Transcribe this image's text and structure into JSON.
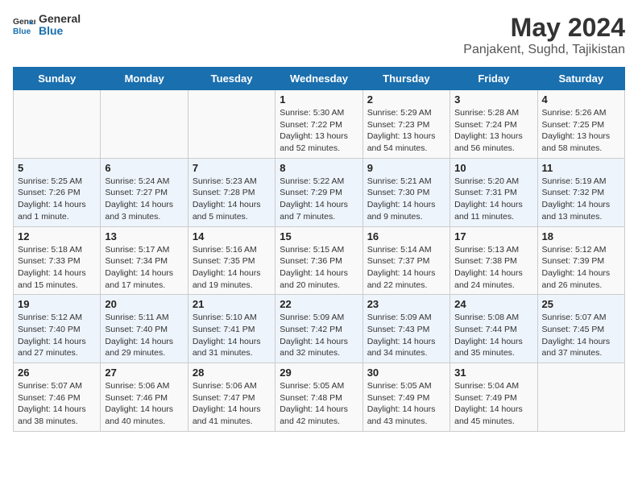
{
  "logo": {
    "line1": "General",
    "line2": "Blue"
  },
  "title": "May 2024",
  "subtitle": "Panjakent, Sughd, Tajikistan",
  "weekdays": [
    "Sunday",
    "Monday",
    "Tuesday",
    "Wednesday",
    "Thursday",
    "Friday",
    "Saturday"
  ],
  "weeks": [
    [
      {
        "day": "",
        "sunrise": "",
        "sunset": "",
        "daylight": ""
      },
      {
        "day": "",
        "sunrise": "",
        "sunset": "",
        "daylight": ""
      },
      {
        "day": "",
        "sunrise": "",
        "sunset": "",
        "daylight": ""
      },
      {
        "day": "1",
        "sunrise": "Sunrise: 5:30 AM",
        "sunset": "Sunset: 7:22 PM",
        "daylight": "Daylight: 13 hours and 52 minutes."
      },
      {
        "day": "2",
        "sunrise": "Sunrise: 5:29 AM",
        "sunset": "Sunset: 7:23 PM",
        "daylight": "Daylight: 13 hours and 54 minutes."
      },
      {
        "day": "3",
        "sunrise": "Sunrise: 5:28 AM",
        "sunset": "Sunset: 7:24 PM",
        "daylight": "Daylight: 13 hours and 56 minutes."
      },
      {
        "day": "4",
        "sunrise": "Sunrise: 5:26 AM",
        "sunset": "Sunset: 7:25 PM",
        "daylight": "Daylight: 13 hours and 58 minutes."
      }
    ],
    [
      {
        "day": "5",
        "sunrise": "Sunrise: 5:25 AM",
        "sunset": "Sunset: 7:26 PM",
        "daylight": "Daylight: 14 hours and 1 minute."
      },
      {
        "day": "6",
        "sunrise": "Sunrise: 5:24 AM",
        "sunset": "Sunset: 7:27 PM",
        "daylight": "Daylight: 14 hours and 3 minutes."
      },
      {
        "day": "7",
        "sunrise": "Sunrise: 5:23 AM",
        "sunset": "Sunset: 7:28 PM",
        "daylight": "Daylight: 14 hours and 5 minutes."
      },
      {
        "day": "8",
        "sunrise": "Sunrise: 5:22 AM",
        "sunset": "Sunset: 7:29 PM",
        "daylight": "Daylight: 14 hours and 7 minutes."
      },
      {
        "day": "9",
        "sunrise": "Sunrise: 5:21 AM",
        "sunset": "Sunset: 7:30 PM",
        "daylight": "Daylight: 14 hours and 9 minutes."
      },
      {
        "day": "10",
        "sunrise": "Sunrise: 5:20 AM",
        "sunset": "Sunset: 7:31 PM",
        "daylight": "Daylight: 14 hours and 11 minutes."
      },
      {
        "day": "11",
        "sunrise": "Sunrise: 5:19 AM",
        "sunset": "Sunset: 7:32 PM",
        "daylight": "Daylight: 14 hours and 13 minutes."
      }
    ],
    [
      {
        "day": "12",
        "sunrise": "Sunrise: 5:18 AM",
        "sunset": "Sunset: 7:33 PM",
        "daylight": "Daylight: 14 hours and 15 minutes."
      },
      {
        "day": "13",
        "sunrise": "Sunrise: 5:17 AM",
        "sunset": "Sunset: 7:34 PM",
        "daylight": "Daylight: 14 hours and 17 minutes."
      },
      {
        "day": "14",
        "sunrise": "Sunrise: 5:16 AM",
        "sunset": "Sunset: 7:35 PM",
        "daylight": "Daylight: 14 hours and 19 minutes."
      },
      {
        "day": "15",
        "sunrise": "Sunrise: 5:15 AM",
        "sunset": "Sunset: 7:36 PM",
        "daylight": "Daylight: 14 hours and 20 minutes."
      },
      {
        "day": "16",
        "sunrise": "Sunrise: 5:14 AM",
        "sunset": "Sunset: 7:37 PM",
        "daylight": "Daylight: 14 hours and 22 minutes."
      },
      {
        "day": "17",
        "sunrise": "Sunrise: 5:13 AM",
        "sunset": "Sunset: 7:38 PM",
        "daylight": "Daylight: 14 hours and 24 minutes."
      },
      {
        "day": "18",
        "sunrise": "Sunrise: 5:12 AM",
        "sunset": "Sunset: 7:39 PM",
        "daylight": "Daylight: 14 hours and 26 minutes."
      }
    ],
    [
      {
        "day": "19",
        "sunrise": "Sunrise: 5:12 AM",
        "sunset": "Sunset: 7:40 PM",
        "daylight": "Daylight: 14 hours and 27 minutes."
      },
      {
        "day": "20",
        "sunrise": "Sunrise: 5:11 AM",
        "sunset": "Sunset: 7:40 PM",
        "daylight": "Daylight: 14 hours and 29 minutes."
      },
      {
        "day": "21",
        "sunrise": "Sunrise: 5:10 AM",
        "sunset": "Sunset: 7:41 PM",
        "daylight": "Daylight: 14 hours and 31 minutes."
      },
      {
        "day": "22",
        "sunrise": "Sunrise: 5:09 AM",
        "sunset": "Sunset: 7:42 PM",
        "daylight": "Daylight: 14 hours and 32 minutes."
      },
      {
        "day": "23",
        "sunrise": "Sunrise: 5:09 AM",
        "sunset": "Sunset: 7:43 PM",
        "daylight": "Daylight: 14 hours and 34 minutes."
      },
      {
        "day": "24",
        "sunrise": "Sunrise: 5:08 AM",
        "sunset": "Sunset: 7:44 PM",
        "daylight": "Daylight: 14 hours and 35 minutes."
      },
      {
        "day": "25",
        "sunrise": "Sunrise: 5:07 AM",
        "sunset": "Sunset: 7:45 PM",
        "daylight": "Daylight: 14 hours and 37 minutes."
      }
    ],
    [
      {
        "day": "26",
        "sunrise": "Sunrise: 5:07 AM",
        "sunset": "Sunset: 7:46 PM",
        "daylight": "Daylight: 14 hours and 38 minutes."
      },
      {
        "day": "27",
        "sunrise": "Sunrise: 5:06 AM",
        "sunset": "Sunset: 7:46 PM",
        "daylight": "Daylight: 14 hours and 40 minutes."
      },
      {
        "day": "28",
        "sunrise": "Sunrise: 5:06 AM",
        "sunset": "Sunset: 7:47 PM",
        "daylight": "Daylight: 14 hours and 41 minutes."
      },
      {
        "day": "29",
        "sunrise": "Sunrise: 5:05 AM",
        "sunset": "Sunset: 7:48 PM",
        "daylight": "Daylight: 14 hours and 42 minutes."
      },
      {
        "day": "30",
        "sunrise": "Sunrise: 5:05 AM",
        "sunset": "Sunset: 7:49 PM",
        "daylight": "Daylight: 14 hours and 43 minutes."
      },
      {
        "day": "31",
        "sunrise": "Sunrise: 5:04 AM",
        "sunset": "Sunset: 7:49 PM",
        "daylight": "Daylight: 14 hours and 45 minutes."
      },
      {
        "day": "",
        "sunrise": "",
        "sunset": "",
        "daylight": ""
      }
    ]
  ]
}
